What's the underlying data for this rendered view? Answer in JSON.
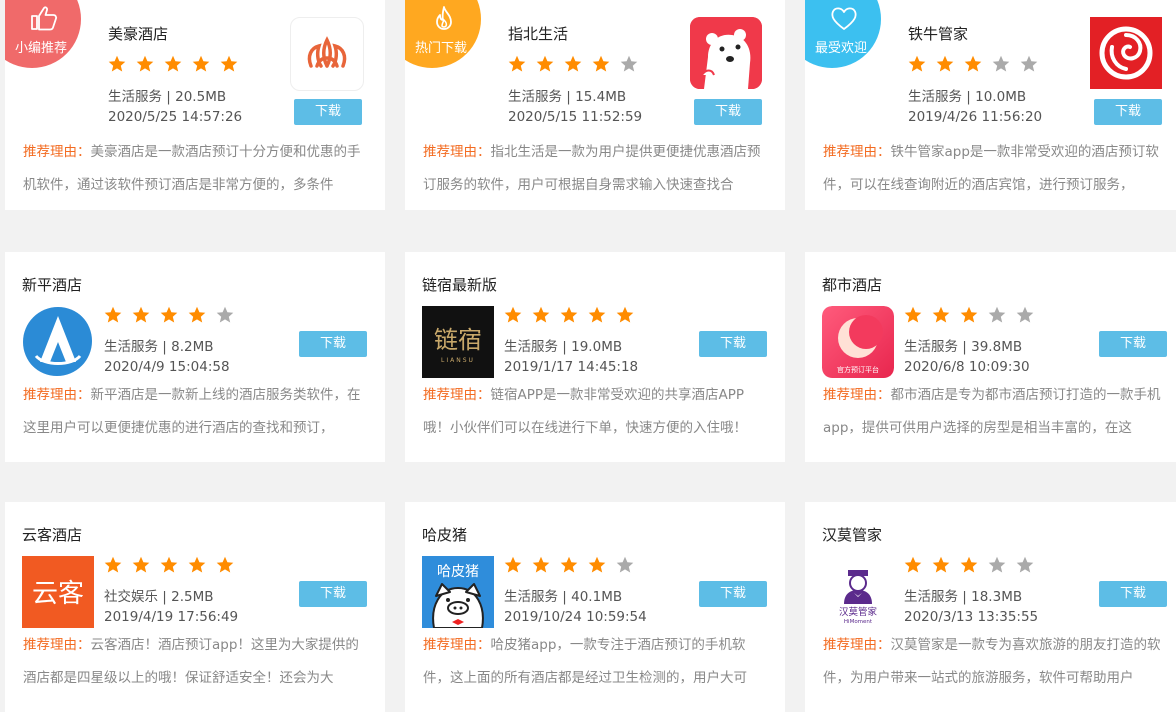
{
  "reason_label": "推荐理由：",
  "download_label": "下载",
  "colors": {
    "star_on": "#ff8c00",
    "star_off": "#aaaaaa",
    "download_bg": "#5dbde6",
    "reason_label": "#f36b21"
  },
  "cards": [
    {
      "name": "美豪酒店",
      "badge": {
        "label": "小编推荐",
        "icon": "thumbs-up-icon",
        "color": "#f06a6a"
      },
      "rating": 5,
      "category": "生活服务",
      "size": "20.5MB",
      "meta": "生活服务 | 20.5MB",
      "date": "2020/5/25 14:57:26",
      "icon": "meihao-logo-icon",
      "reason": "美豪酒店是一款酒店预订十分方便和优惠的手机软件，通过该软件预订酒店是非常方便的，多条件"
    },
    {
      "name": "指北生活",
      "badge": {
        "label": "热门下载",
        "icon": "flame-icon",
        "color": "#ffa820"
      },
      "rating": 4,
      "category": "生活服务",
      "size": "15.4MB",
      "meta": "生活服务 | 15.4MB",
      "date": "2020/5/15 11:52:59",
      "icon": "polar-bear-icon",
      "reason": "指北生活是一款为用户提供更便捷优惠酒店预订服务的软件，用户可根据自身需求输入快速查找合"
    },
    {
      "name": "铁牛管家",
      "badge": {
        "label": "最受欢迎",
        "icon": "heart-icon",
        "color": "#3cc0f0"
      },
      "rating": 3,
      "category": "生活服务",
      "size": "10.0MB",
      "meta": "生活服务 | 10.0MB",
      "date": "2019/4/26 11:56:20",
      "icon": "tieniu-logo-icon",
      "reason": "铁牛管家app是一款非常受欢迎的酒店预订软件，可以在线查询附近的酒店宾馆，进行预订服务，"
    },
    {
      "name": "新平酒店",
      "rating": 4,
      "category": "生活服务",
      "size": "8.2MB",
      "meta": "生活服务 | 8.2MB",
      "date": "2020/4/9 15:04:58",
      "icon": "xinping-logo-icon",
      "reason": "新平酒店是一款新上线的酒店服务类软件，在这里用户可以更便捷优惠的进行酒店的查找和预订，"
    },
    {
      "name": "链宿最新版",
      "rating": 5,
      "category": "生活服务",
      "size": "19.0MB",
      "meta": "生活服务 | 19.0MB",
      "date": "2019/1/17 14:45:18",
      "icon": "liansu-logo-icon",
      "icon_text": "链宿",
      "icon_subtext": "LIANSU",
      "reason": "链宿APP是一款非常受欢迎的共享酒店APP哦！小伙伴们可以在线进行下单，快速方便的入住哦！"
    },
    {
      "name": "都市酒店",
      "rating": 3,
      "category": "生活服务",
      "size": "39.8MB",
      "meta": "生活服务 | 39.8MB",
      "date": "2020/6/8 10:09:30",
      "icon": "dushi-logo-icon",
      "icon_text": "官方预订平台",
      "reason": "都市酒店是专为都市酒店预订打造的一款手机app，提供可供用户选择的房型是相当丰富的，在这"
    },
    {
      "name": "云客酒店",
      "rating": 5,
      "category": "社交娱乐",
      "size": "2.5MB",
      "meta": "社交娱乐 | 2.5MB",
      "date": "2019/4/19 17:56:49",
      "icon": "yunke-logo-icon",
      "icon_text": "云客",
      "reason": "云客酒店！酒店预订app！这里为大家提供的酒店都是四星级以上的哦！保证舒适安全！还会为大"
    },
    {
      "name": "哈皮猪",
      "rating": 4,
      "category": "生活服务",
      "size": "40.1MB",
      "meta": "生活服务 | 40.1MB",
      "date": "2019/10/24 10:59:54",
      "icon": "pig-icon",
      "icon_text": "哈皮猪",
      "reason": "哈皮猪app，一款专注于酒店预订的手机软件，这上面的所有酒店都是经过卫生检测的，用户大可"
    },
    {
      "name": "汉莫管家",
      "rating": 3,
      "category": "生活服务",
      "size": "18.3MB",
      "meta": "生活服务 | 18.3MB",
      "date": "2020/3/13 13:35:55",
      "icon": "butler-icon",
      "icon_text": "汉莫管家",
      "icon_subtext": "HiMoment",
      "reason": "汉莫管家是一款专为喜欢旅游的朋友打造的软件，为用户带来一站式的旅游服务，软件可帮助用户"
    }
  ]
}
